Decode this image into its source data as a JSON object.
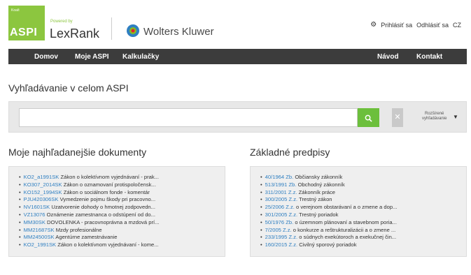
{
  "header": {
    "logo_small": "Koaít",
    "logo_text": "ASPI",
    "powered_by": "Powered by",
    "lexrank": "LexRank",
    "wolters_kluwer": "Wolters Kluwer",
    "links": {
      "login": "Prihlásiť sa",
      "logout": "Odhlásiť sa",
      "lang": "CZ"
    }
  },
  "nav": {
    "home": "Domov",
    "my_aspi": "Moje ASPI",
    "calculators": "Kalkulačky",
    "guide": "Návod",
    "contact": "Kontakt"
  },
  "search": {
    "title": "Vyhľadávanie v celom ASPI",
    "placeholder": "",
    "value": "",
    "advanced_line1": "Rozšírené",
    "advanced_line2": "vyhľadávanie"
  },
  "my_docs": {
    "title": "Moje najhľadanejšie dokumenty",
    "items": [
      {
        "code": "KO2_a1991SK",
        "text": "Zákon o kolektívnom vyjednávaní - prak..."
      },
      {
        "code": "KO307_2014SK",
        "text": "Zákon o oznamovaní protispoločensk..."
      },
      {
        "code": "KO152_1994SK",
        "text": "Zákon o sociálnom fonde - komentár"
      },
      {
        "code": "PJU420306SK",
        "text": "Vymedzenie pojmu škody pri pracovno..."
      },
      {
        "code": "NV1601SK",
        "text": "Uzatvorenie dohody o hmotnej zodpovedn..."
      },
      {
        "code": "VZ13076",
        "text": "Oznámenie zamestnanca o odstúpení od do..."
      },
      {
        "code": "MM30SK",
        "text": "DOVOLENKA - pracovnoprávna a mzdová prí..."
      },
      {
        "code": "MM21687SK",
        "text": "Mzdy profesionálne"
      },
      {
        "code": "MM24500SK",
        "text": "Agentúrne zamestnávanie"
      },
      {
        "code": "KO2_1991SK",
        "text": "Zákon o kolektívnom vyjednávaní - kome..."
      }
    ]
  },
  "basic": {
    "title": "Základné predpisy",
    "items": [
      {
        "code": "40/1964 Zb.",
        "text": "Občiansky zákonník"
      },
      {
        "code": "513/1991 Zb.",
        "text": "Obchodný zákonník"
      },
      {
        "code": "311/2001 Z.z.",
        "text": "Zákonník práce"
      },
      {
        "code": "300/2005 Z.z.",
        "text": "Trestný zákon"
      },
      {
        "code": "25/2006 Z.z.",
        "text": "o verejnom obstarávaní a o zmene a dop..."
      },
      {
        "code": "301/2005 Z.z.",
        "text": "Trestný poriadok"
      },
      {
        "code": "50/1976 Zb.",
        "text": "o územnom plánovaní a stavebnom poria..."
      },
      {
        "code": "7/2005 Z.z.",
        "text": "o konkurze a reštrukturalizácii a o zmene ..."
      },
      {
        "code": "233/1995 Z.z.",
        "text": "o súdnych exekútoroch a exekučnej čin..."
      },
      {
        "code": "160/2015 Z.z.",
        "text": "Civilný sporový poriadok"
      }
    ]
  },
  "colors": {
    "brand_green": "#8cc63f",
    "nav_bg": "#3c3c3c",
    "link_blue": "#2f7fc1",
    "search_green": "#6cbf3c"
  }
}
